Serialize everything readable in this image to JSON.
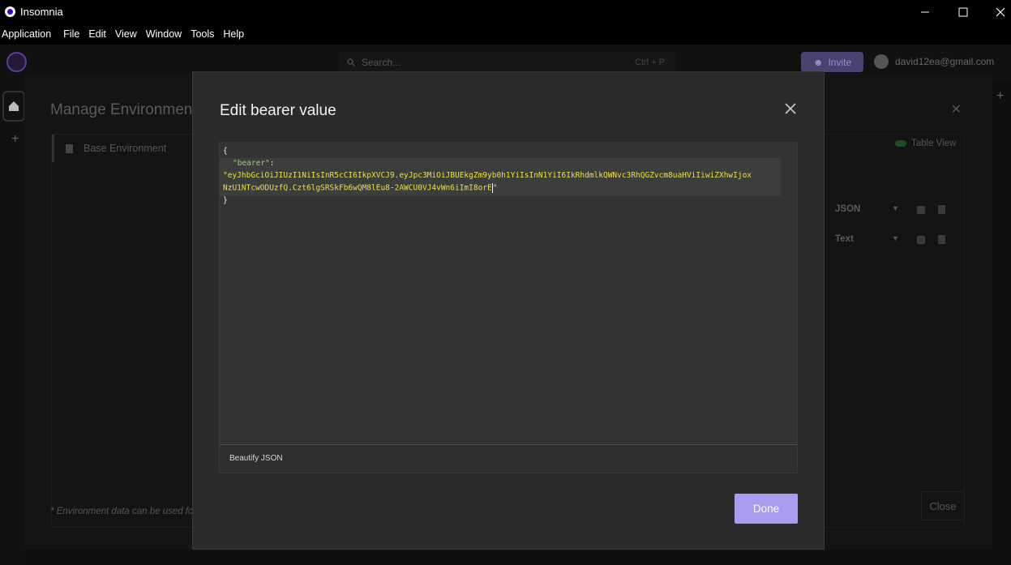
{
  "window": {
    "title": "Insomnia",
    "minimize_icon": "minimize-icon",
    "maximize_icon": "maximize-icon",
    "close_icon": "close-icon"
  },
  "menubar": {
    "items": [
      "Application",
      "File",
      "Edit",
      "View",
      "Window",
      "Tools",
      "Help"
    ]
  },
  "topbar": {
    "search_placeholder": "Search...",
    "search_shortcut": "Ctrl + P",
    "invite_label": "Invite",
    "user_email": "david12ea@gmail.com"
  },
  "manage_environments": {
    "title": "Manage Environments",
    "env_item": "Base Environment",
    "table_view_label": "Table View",
    "rows": [
      {
        "type": "JSON"
      },
      {
        "type": "Text"
      }
    ],
    "footnote": "* Environment data can be used for N",
    "close_label": "Close"
  },
  "modal": {
    "title": "Edit bearer value",
    "editor": {
      "open_brace": "{",
      "key": "\"bearer\"",
      "colon": ":",
      "value_line1": "\"eyJhbGciOiJIUzI1NiIsInR5cCI6IkpXVCJ9.eyJpc3MiOiJBUEkgZm9yb0h1YiIsInN1YiI6IkRhdmlkQWNvc3RhQGZvcm8uaHViIiwiZXhwIjox",
      "value_line2": "NzU1NTcwODUzfQ.Czt6lgSRSkFb6wQM8lEu8-2AWCU0VJ4vWn6iImI8orE",
      "value_end_quote": "\"",
      "close_brace": "}"
    },
    "beautify_label": "Beautify JSON",
    "done_label": "Done"
  },
  "colors": {
    "accent": "#a89cf0",
    "json_key": "#8fd16e",
    "json_string": "#e8e04a"
  }
}
